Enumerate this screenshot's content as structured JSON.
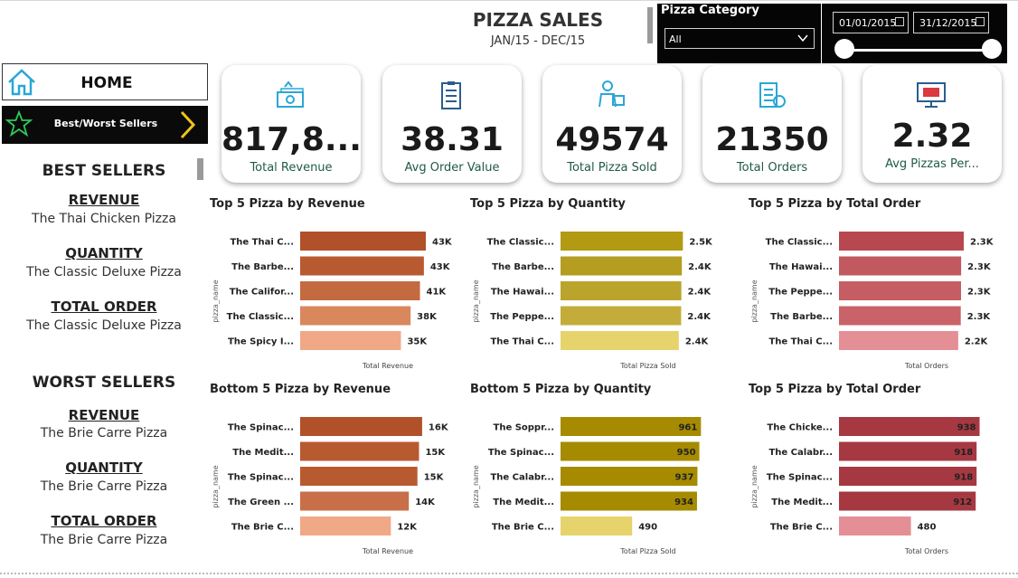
{
  "header": {
    "title": "PIZZA SALES",
    "subtitle": "JAN/15 - DEC/15"
  },
  "filters": {
    "category_label": "Pizza Category",
    "category_value": "All",
    "date_start": "01/01/2015",
    "date_end": "31/12/2015"
  },
  "nav": {
    "home_label": "HOME",
    "best_worst_label": "Best/Worst Sellers"
  },
  "sidebar": {
    "best_heading": "BEST SELLERS",
    "worst_heading": "WORST SELLERS",
    "best": [
      {
        "label": "REVENUE",
        "value": "The Thai Chicken Pizza"
      },
      {
        "label": "QUANTITY",
        "value": "The Classic Deluxe Pizza"
      },
      {
        "label": "TOTAL ORDER",
        "value": "The Classic Deluxe Pizza"
      }
    ],
    "worst": [
      {
        "label": "REVENUE",
        "value": "The Brie Carre Pizza"
      },
      {
        "label": "QUANTITY",
        "value": "The Brie Carre Pizza"
      },
      {
        "label": "TOTAL ORDER",
        "value": "The Brie Carre Pizza"
      }
    ]
  },
  "kpis": [
    {
      "value": "817,8...",
      "label": "Total Revenue",
      "icon": "money-icon"
    },
    {
      "value": "38.31",
      "label": "Avg Order Value",
      "icon": "clipboard-icon"
    },
    {
      "value": "49574",
      "label": "Total Pizza Sold",
      "icon": "delivery-icon"
    },
    {
      "value": "21350",
      "label": "Total Orders",
      "icon": "order-list-icon"
    },
    {
      "value": "2.32",
      "label": "Avg Pizzas Per...",
      "icon": "monitor-icon"
    }
  ],
  "colors": {
    "revenue": [
      "#b0512a",
      "#b85a30",
      "#c46a40",
      "#d9875d",
      "#f0a887"
    ],
    "quantity": [
      "#b29a12",
      "#b59d20",
      "#bba42b",
      "#c3ac3a",
      "#e6d36c"
    ],
    "orders": [
      "#b8484f",
      "#c05a60",
      "#c55d63",
      "#c96369",
      "#e48e95"
    ],
    "bottom_revenue": [
      "#b0512a",
      "#b85a30",
      "#b85a30",
      "#c86f4a",
      "#f0a887"
    ],
    "bottom_quantity": [
      "#a68b00",
      "#a68b00",
      "#a68b00",
      "#a68b00",
      "#e6d36c"
    ],
    "bottom_orders": [
      "#a63842",
      "#a63842",
      "#a63842",
      "#a63842",
      "#e48e95"
    ]
  },
  "chart_data": [
    {
      "type": "bar",
      "title": "Top 5 Pizza by Revenue",
      "xlabel": "Total Revenue",
      "ylabel": "pizza_name",
      "categories": [
        "The Thai C...",
        "The Barbe...",
        "The Califor...",
        "The Classic...",
        "The Spicy I..."
      ],
      "values": [
        43434,
        42768,
        41410,
        38180,
        34831
      ],
      "labels": [
        "43K",
        "43K",
        "41K",
        "38K",
        "35K"
      ],
      "xlim": [
        0,
        50000
      ],
      "colorKey": "revenue"
    },
    {
      "type": "bar",
      "title": "Top 5 Pizza by Quantity",
      "xlabel": "Total Pizza Sold",
      "ylabel": "pizza_name",
      "categories": [
        "The Classic...",
        "The Barbe...",
        "The Hawai...",
        "The Peppe...",
        "The Thai C..."
      ],
      "values": [
        2453,
        2432,
        2422,
        2418,
        2371
      ],
      "labels": [
        "2.5K",
        "2.4K",
        "2.4K",
        "2.4K",
        "2.4K"
      ],
      "xlim": [
        0,
        2900
      ],
      "colorKey": "quantity"
    },
    {
      "type": "bar",
      "title": "Top 5 Pizza by Total Order",
      "xlabel": "Total Orders",
      "ylabel": "pizza_name",
      "categories": [
        "The Classic...",
        "The Hawai...",
        "The Peppe...",
        "The Barbe...",
        "The Thai C..."
      ],
      "values": [
        2329,
        2280,
        2278,
        2273,
        2225
      ],
      "labels": [
        "2.3K",
        "2.3K",
        "2.3K",
        "2.3K",
        "2.2K"
      ],
      "xlim": [
        0,
        2700
      ],
      "colorKey": "orders"
    },
    {
      "type": "bar",
      "title": "Bottom 5 Pizza by Revenue",
      "xlabel": "Total Revenue",
      "ylabel": "pizza_name",
      "categories": [
        "The Spinac...",
        "The Medit...",
        "The Spinac...",
        "The Green ...",
        "The Brie C..."
      ],
      "values": [
        15600,
        15200,
        15000,
        13900,
        11600
      ],
      "labels": [
        "16K",
        "15K",
        "15K",
        "14K",
        "12K"
      ],
      "xlim": [
        0,
        18500
      ],
      "colorKey": "bottom_revenue"
    },
    {
      "type": "bar",
      "title": "Bottom 5 Pizza by Quantity",
      "xlabel": "Total Pizza Sold",
      "ylabel": "pizza_name",
      "categories": [
        "The Soppr...",
        "The Spinac...",
        "The Calabr...",
        "The Medit...",
        "The Brie C..."
      ],
      "values": [
        961,
        950,
        937,
        934,
        490
      ],
      "labels": [
        "961",
        "950",
        "937",
        "934",
        "490"
      ],
      "xlim": [
        0,
        990
      ],
      "colorKey": "bottom_quantity"
    },
    {
      "type": "bar",
      "title": "Top 5 Pizza by Total Order",
      "xlabel": "Total Orders",
      "ylabel": "pizza_name",
      "categories": [
        "The Chicke...",
        "The Calabr...",
        "The Spinac...",
        "The Medit...",
        "The Brie C..."
      ],
      "values": [
        938,
        918,
        918,
        912,
        480
      ],
      "labels": [
        "938",
        "918",
        "918",
        "912",
        "480"
      ],
      "xlim": [
        0,
        965
      ],
      "colorKey": "bottom_orders"
    }
  ]
}
